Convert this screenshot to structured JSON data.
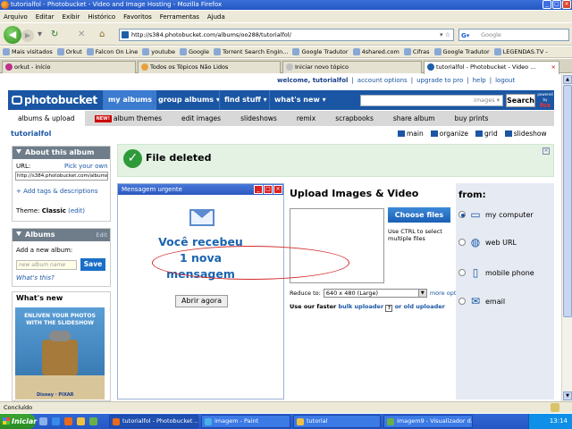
{
  "window": {
    "title": "tutorialfol - Photobucket - Video and Image Hosting - Mozilla Firefox"
  },
  "menu": [
    "Arquivo",
    "Editar",
    "Exibir",
    "Histórico",
    "Favoritos",
    "Ferramentas",
    "Ajuda"
  ],
  "address": {
    "url": "http://s384.photobucket.com/albums/oo288/tutorialfol/"
  },
  "search": {
    "placeholder": "Google"
  },
  "bookmarks": [
    "Mais visitados",
    "Orkut",
    "Falcon On Line",
    "youtube",
    "Google",
    "Torrent Search Engin...",
    "Google Tradutor",
    "4shared.com",
    "Cifras",
    "Google Tradutor",
    "LEGENDAS.TV -"
  ],
  "tabs": [
    {
      "label": "orkut - início",
      "color": "#c0308a"
    },
    {
      "label": "Todos os Tópicos Não Lidos",
      "color": "#e8a040"
    },
    {
      "label": "Iniciar novo tópico",
      "color": "#c0c0c0"
    },
    {
      "label": "tutorialfol - Photobucket - Video ...",
      "color": "#1f5fa8"
    }
  ],
  "pb": {
    "welcome": "welcome, tutorialfol",
    "links": [
      "account options",
      "upgrade to pro",
      "help",
      "logout"
    ],
    "logo": "photobucket",
    "nav": [
      "my albums",
      "group albums ▾",
      "find stuff ▾",
      "what's new ▾"
    ],
    "search_scope": "images ▾",
    "search_button": "Search",
    "powered": "powered by",
    "powered_brand": "fox",
    "subnav": [
      "albums & upload",
      "album themes",
      "edit images",
      "slideshows",
      "remix",
      "scrapbooks",
      "share album",
      "buy prints"
    ],
    "new_badge": "NEW!",
    "username": "tutorialfol",
    "view_options": [
      "main",
      "organize",
      "grid",
      "slideshow"
    ]
  },
  "about": {
    "title": "About this album",
    "url_label": "URL:",
    "pick": "Pick your own",
    "url_value": "http://s384.photobucket.com/albums",
    "tags_link": "+ Add tags & descriptions",
    "theme_label": "Theme:",
    "theme_value": "Classic",
    "theme_edit": "(edit)"
  },
  "albums": {
    "title": "Albums",
    "edit": "Edit",
    "add_label": "Add a new album:",
    "input_placeholder": "new album name",
    "save": "Save",
    "whats_this": "What's this?"
  },
  "whatsnew": {
    "title": "What's new",
    "promo_line1": "ENLIVEN YOUR PHOTOS",
    "promo_line2": "WITH THE SLIDESHOW",
    "promo_brand": "Disney · PIXAR"
  },
  "notice": {
    "text": "File deleted"
  },
  "msgwin": {
    "title": "Mensagem urgente",
    "line1": "Você recebeu",
    "line2": "1 nova",
    "line3": "mensagem",
    "button": "Abrir agora"
  },
  "upload": {
    "title": "Upload Images & Video",
    "choose": "Choose files",
    "hint": "Use CTRL to select multiple files",
    "reduce_label": "Reduce to:",
    "reduce_value": "640 x 480 (Large)",
    "more_options": "more options",
    "faster_prefix": "Use our faster",
    "bulk": "bulk uploader",
    "or_old": "or old uploader"
  },
  "from": {
    "title": "from:",
    "sources": [
      "my computer",
      "web URL",
      "mobile phone",
      "email"
    ]
  },
  "status": {
    "text": "Concluído"
  },
  "taskbar": {
    "start": "Iniciar",
    "tasks": [
      {
        "label": "tutorialfol - Photobucket ...",
        "color": "#e86a1a"
      },
      {
        "label": "imagem - Paint",
        "color": "#4ab0e8"
      },
      {
        "label": "tutorial",
        "color": "#f0c040"
      },
      {
        "label": "imagem9 - Visualizador d...",
        "color": "#6ab04a"
      }
    ],
    "clock": "13:14"
  }
}
